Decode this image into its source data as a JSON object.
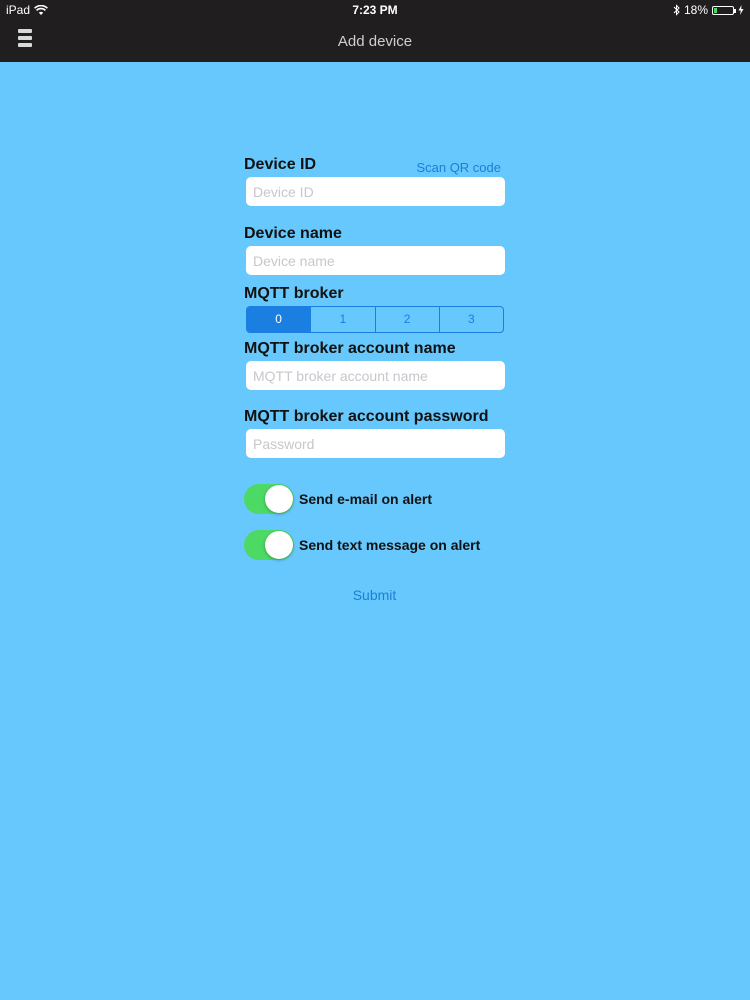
{
  "status_bar": {
    "carrier": "iPad",
    "time": "7:23 PM",
    "battery_percent": "18%",
    "battery_level": 0.18,
    "icons": [
      "wifi-icon",
      "bluetooth-icon",
      "battery-icon",
      "charging-bolt-icon"
    ]
  },
  "nav": {
    "title": "Add device",
    "menu_icon": "hamburger-menu-icon"
  },
  "form": {
    "device_id": {
      "label": "Device ID",
      "placeholder": "Device ID",
      "value": "",
      "link": "Scan QR code"
    },
    "device_name": {
      "label": "Device name",
      "placeholder": "Device name",
      "value": ""
    },
    "mqtt_broker": {
      "label": "MQTT broker",
      "options": [
        "0",
        "1",
        "2",
        "3"
      ],
      "selected": "0"
    },
    "mqtt_account_name": {
      "label": "MQTT broker account name",
      "placeholder": "MQTT broker account name",
      "value": ""
    },
    "mqtt_account_password": {
      "label": "MQTT broker account password",
      "placeholder": "Password",
      "value": ""
    },
    "toggles": [
      {
        "label": "Send e-mail on alert",
        "on": true
      },
      {
        "label": "Send text message on alert",
        "on": true
      }
    ],
    "submit_label": "Submit"
  },
  "colors": {
    "background": "#66c8fc",
    "nav_bar": "#211e1f",
    "accent": "#1a7fe0",
    "switch_on": "#4cd964"
  }
}
